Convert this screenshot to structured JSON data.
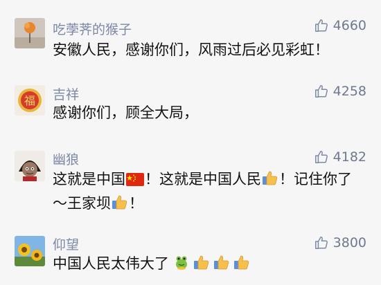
{
  "comments": [
    {
      "username": "吃荸荠的猴子",
      "likes": "4660",
      "text": "安徽人民，感谢你们，风雨过后必见彩虹！"
    },
    {
      "username": "吉祥",
      "likes": "4258",
      "text": "感谢你们，顾全大局，"
    },
    {
      "username": "幽狼",
      "likes": "4182",
      "text_parts": [
        "这就是中国",
        "！这就是中国人民",
        "！记住你了～王家坝",
        "！"
      ]
    },
    {
      "username": "仰望",
      "likes": "3800",
      "text": "中国人民太伟大了"
    }
  ],
  "icons": {
    "like": "thumbs-up-outline-icon",
    "flag": "china-flag-emoji",
    "thumbs": "thumbs-up-emoji",
    "frog": "frog-emoji"
  },
  "colors": {
    "background": "#f6f6f6",
    "username": "#7b88a6",
    "like_count": "#6e7890",
    "text": "#111111"
  }
}
